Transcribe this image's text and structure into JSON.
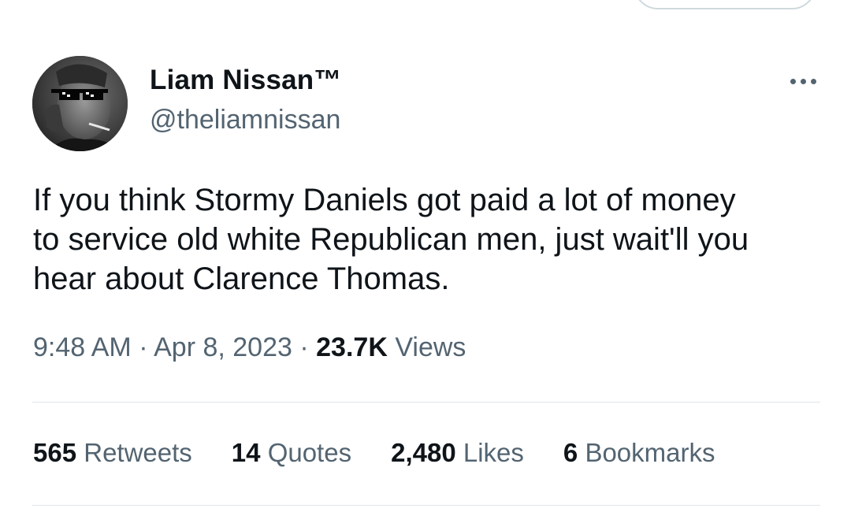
{
  "author": {
    "display_name": "Liam Nissan™",
    "handle": "@theliamnissan",
    "avatar_icon": "avatar-photo"
  },
  "more_icon": "more-horizontal-icon",
  "tweet": {
    "text_lines": [
      "If you think Stormy Daniels got paid a lot of money",
      "to service old white Republican men, just wait'll you",
      "hear about Clarence Thomas."
    ],
    "time": "9:48 AM",
    "date": "Apr 8, 2023",
    "separator": "·",
    "views_count": "23.7K",
    "views_label": "Views"
  },
  "stats": [
    {
      "count": "565",
      "label": "Retweets"
    },
    {
      "count": "14",
      "label": "Quotes"
    },
    {
      "count": "2,480",
      "label": "Likes"
    },
    {
      "count": "6",
      "label": "Bookmarks"
    }
  ],
  "colors": {
    "text_primary": "#0f1419",
    "text_secondary": "#536471",
    "divider": "#e1e6ea"
  }
}
